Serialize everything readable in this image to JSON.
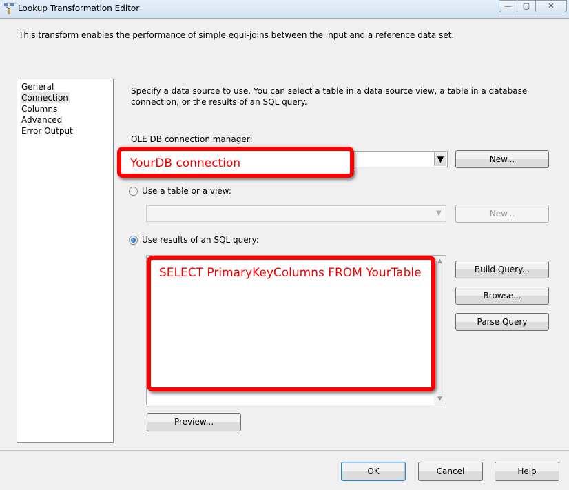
{
  "window": {
    "title": "Lookup Transformation Editor",
    "minimize": "—",
    "maximize": "▢",
    "close": "✕"
  },
  "description": "This transform enables the performance of simple equi-joins between the input and a reference data set.",
  "nav": {
    "items": [
      {
        "label": "General"
      },
      {
        "label": "Connection",
        "selected": true
      },
      {
        "label": "Columns"
      },
      {
        "label": "Advanced"
      },
      {
        "label": "Error Output"
      }
    ]
  },
  "connection": {
    "intro": "Specify a data source to use. You can select a table in a data source view, a table in a database connection, or the results of an SQL query.",
    "oledb_label": "OLE DB connection manager:",
    "oledb_value": "YourDB connection",
    "new_label": "New...",
    "use_table_label": "Use a table or a view:",
    "use_table_checked": false,
    "table_new_label": "New...",
    "use_query_label": "Use results of an SQL query:",
    "use_query_checked": true,
    "query_text": "SELECT PrimaryKeyColumns FROM YourTable",
    "build_query": "Build Query...",
    "browse": "Browse...",
    "parse_query": "Parse Query",
    "preview": "Preview..."
  },
  "footer": {
    "ok": "OK",
    "cancel": "Cancel",
    "help": "Help"
  },
  "colors": {
    "callout": "#ff0000",
    "selected_nav": "#e5e5e5"
  }
}
